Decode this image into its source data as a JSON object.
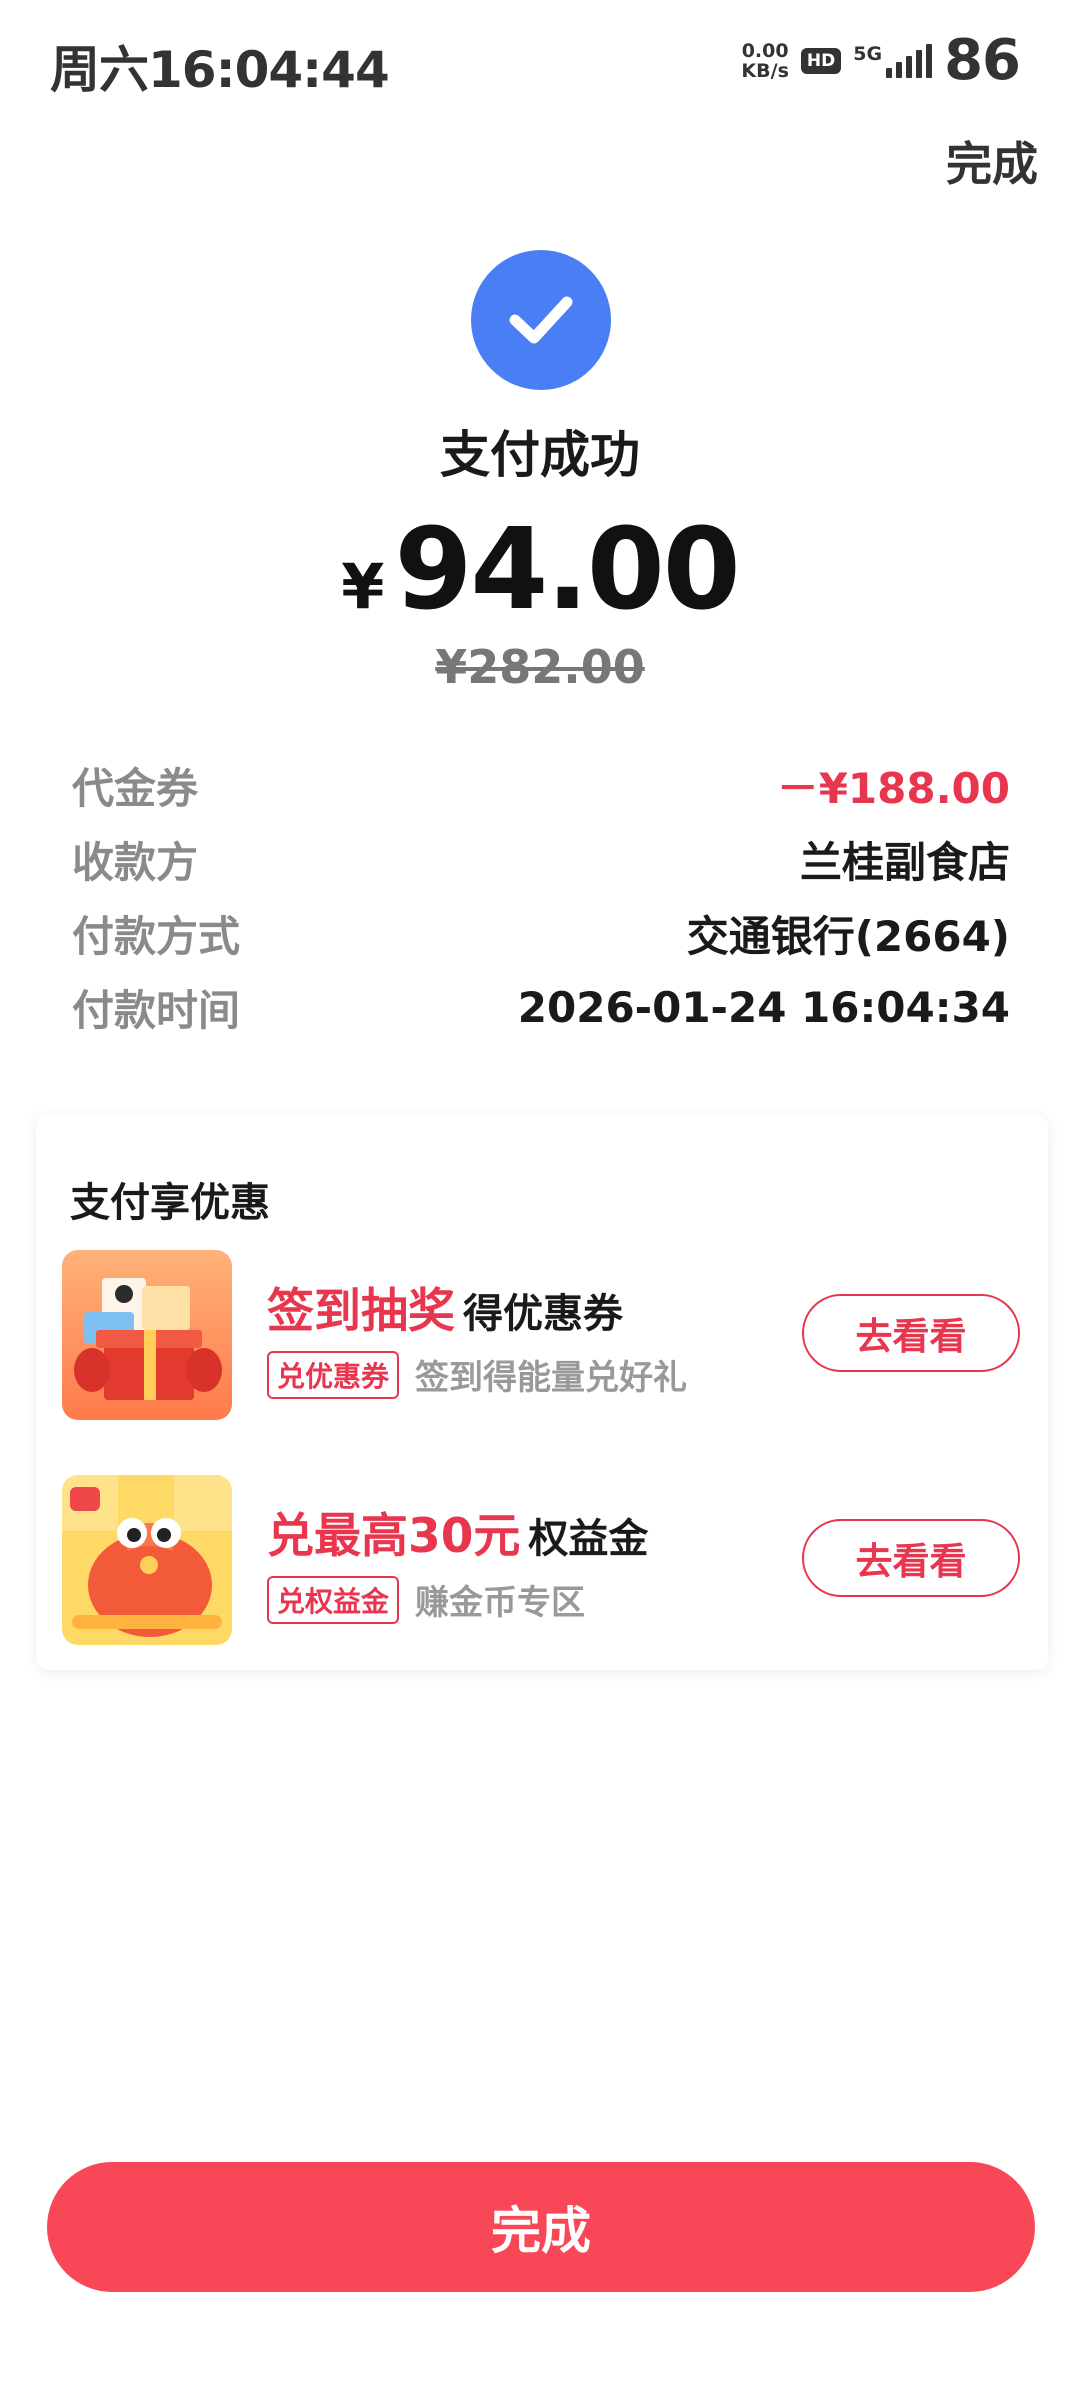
{
  "status_bar": {
    "time": "周六16:04:44",
    "net_speed_value": "0.00",
    "net_speed_unit": "KB/s",
    "hd": "HD",
    "network": "5G",
    "battery": "86"
  },
  "header": {
    "done_label": "完成"
  },
  "result": {
    "title": "支付成功",
    "currency": "¥",
    "amount": "94.00",
    "original_amount": "¥282.00"
  },
  "details": [
    {
      "label": "代金券",
      "value": "－¥188.00"
    },
    {
      "label": "收款方",
      "value": "兰桂副食店"
    },
    {
      "label": "付款方式",
      "value": "交通银行(2664)"
    },
    {
      "label": "付款时间",
      "value": "2026-01-24 16:04:34"
    }
  ],
  "promo_card": {
    "title": "支付享优惠",
    "items": [
      {
        "headline_red": "签到抽奖",
        "headline_dark": "得优惠券",
        "tag": "兑优惠券",
        "subtitle": "签到得能量兑好礼",
        "button": "去看看",
        "thumb_icon": "gift-box-icon"
      },
      {
        "headline_red": "兑最高30元",
        "headline_dark": "权益金",
        "tag": "兑权益金",
        "subtitle": "赚金币专区",
        "button": "去看看",
        "thumb_icon": "lucky-bag-icon"
      }
    ]
  },
  "bottom_button": {
    "label": "完成"
  },
  "colors": {
    "accent_blue": "#4a7ef5",
    "accent_red": "#e8364f",
    "button_red": "#f84858"
  }
}
